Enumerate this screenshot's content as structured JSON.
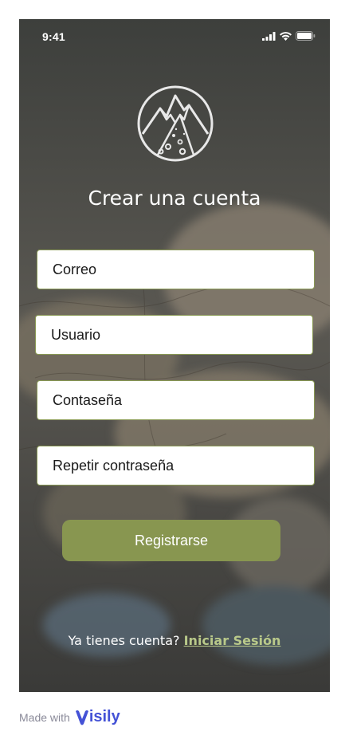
{
  "status_bar": {
    "time": "9:41"
  },
  "title": "Crear una cuenta",
  "fields": [
    {
      "placeholder": "Correo"
    },
    {
      "placeholder": "Usuario"
    },
    {
      "placeholder": "Contaseña"
    },
    {
      "placeholder": "Repetir contraseña"
    }
  ],
  "register_button": "Registrarse",
  "footer": {
    "prompt": "Ya tienes cuenta?",
    "login_link": "Iniciar Sesión"
  },
  "made_with": {
    "label": "Made with",
    "brand": "isily"
  },
  "colors": {
    "accent": "#889650",
    "link": "#b9c98a",
    "brand": "#4452d6"
  }
}
